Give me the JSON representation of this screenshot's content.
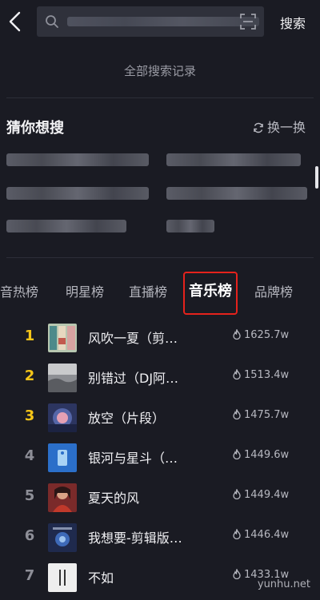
{
  "header": {
    "search_button": "搜索",
    "search_placeholder": ""
  },
  "history_link": "全部搜索记录",
  "guess": {
    "title": "猜你想搜",
    "refresh_label": "换一换"
  },
  "tabs": [
    {
      "label": "音热榜",
      "active": false
    },
    {
      "label": "明星榜",
      "active": false
    },
    {
      "label": "直播榜",
      "active": false
    },
    {
      "label": "音乐榜",
      "active": true
    },
    {
      "label": "品牌榜",
      "active": false
    }
  ],
  "music_chart": [
    {
      "rank": "1",
      "title": "风吹一夏（剪…",
      "heat": "1625.7w"
    },
    {
      "rank": "2",
      "title": "别错过（DJ阿…",
      "heat": "1513.4w"
    },
    {
      "rank": "3",
      "title": "放空（片段）",
      "heat": "1475.7w"
    },
    {
      "rank": "4",
      "title": "银河与星斗（…",
      "heat": "1449.6w"
    },
    {
      "rank": "5",
      "title": "夏天的风",
      "heat": "1449.4w"
    },
    {
      "rank": "6",
      "title": "我想要-剪辑版…",
      "heat": "1446.4w"
    },
    {
      "rank": "7",
      "title": "不如",
      "heat": "1433.1w"
    }
  ],
  "colors": {
    "background": "#1a1b23",
    "rank_top": "#f5c518",
    "rank_other": "#8d8e97",
    "highlight_box": "#e5221c"
  },
  "watermark": "yunhu.net"
}
